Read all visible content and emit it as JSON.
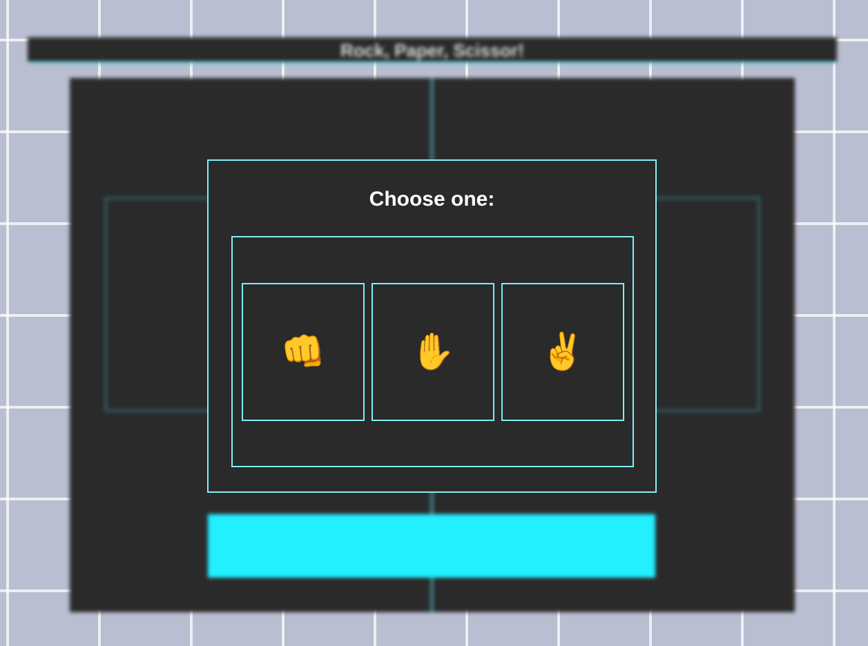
{
  "header": {
    "title": "Rock, Paper, Scissor!"
  },
  "modal": {
    "title": "Choose one:",
    "choices": [
      {
        "name": "rock",
        "icon": "fist-icon",
        "glyph": "👊"
      },
      {
        "name": "paper",
        "icon": "raised-hand-icon",
        "glyph": "✋"
      },
      {
        "name": "scissors",
        "icon": "victory-hand-icon",
        "glyph": "✌️"
      }
    ]
  },
  "colors": {
    "accent": "#22f0ff",
    "outline": "#7ef0f8",
    "panel": "#2a2a2a",
    "background": "#b9bed1"
  }
}
